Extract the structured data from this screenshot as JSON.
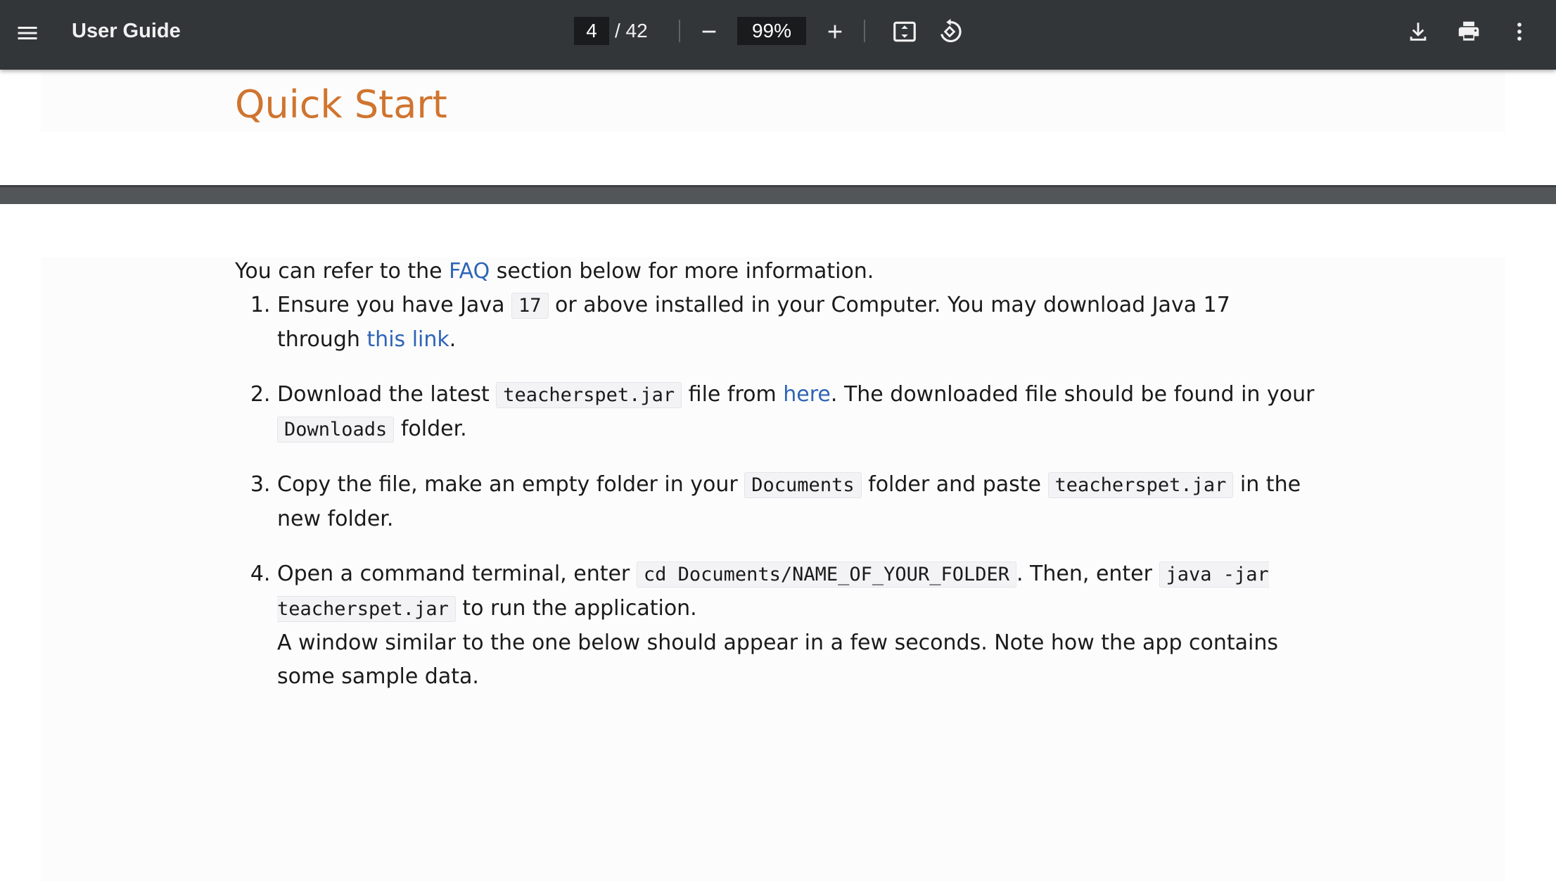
{
  "toolbar": {
    "title": "User Guide",
    "current_page": "4",
    "page_total": "/ 42",
    "zoom": "99%",
    "icons": [
      "menu-icon",
      "zoom-out-icon",
      "zoom-in-icon",
      "fit-to-page-icon",
      "rotate-icon",
      "download-icon",
      "print-icon",
      "more-vert-icon"
    ]
  },
  "document": {
    "heading": "Quick Start",
    "intro": {
      "before": "You can refer to the ",
      "link": "FAQ",
      "after": " section below for more information."
    },
    "steps": [
      {
        "t1": "Ensure you have Java ",
        "code1": "17",
        "t2": " or above installed in your Computer. You may download Java 17 through ",
        "link": "this link",
        "t3": "."
      },
      {
        "t1": "Download the latest ",
        "code1": "teacherspet.jar",
        "t2": " file from ",
        "link": "here",
        "t3": ". The downloaded file should be found in your ",
        "code2": "Downloads",
        "t4": " folder."
      },
      {
        "t1": "Copy the file, make an empty folder in your ",
        "code1": "Documents",
        "t2": " folder and paste ",
        "code2": "teacherspet.jar",
        "t3": " in the new folder."
      },
      {
        "t1": "Open a command terminal, enter ",
        "code1": "cd Documents/NAME_OF_YOUR_FOLDER",
        "t2": ". Then, enter ",
        "code2": "java -jar teacherspet.jar",
        "t3": " to run the application.",
        "t4": "A window similar to the one below should appear in a few seconds. Note how the app contains some sample data."
      }
    ]
  },
  "colors": {
    "toolbar_bg": "#323639",
    "heading": "#d0742f",
    "link": "#2f64b7",
    "page_gap": "#525659"
  }
}
